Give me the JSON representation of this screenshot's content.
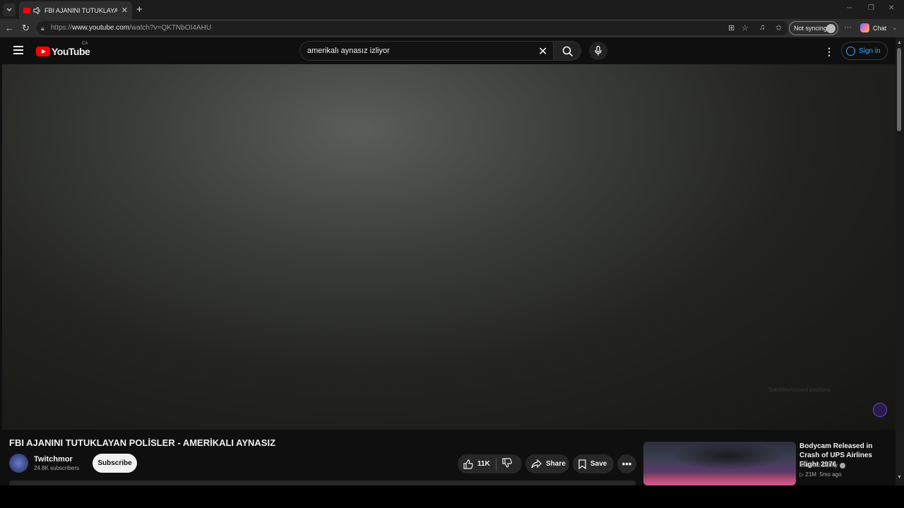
{
  "browser": {
    "tab_title": "FBI AJANINI TUTUKLAYAN POLİSLER - AMERİKALI AYNASIZ",
    "url_prefix": "https://",
    "url_host": "www.youtube.com",
    "url_path": "/watch?v=QKTNbOI4AHU",
    "sync_label": "Not syncing",
    "chat_label": "Chat"
  },
  "youtube": {
    "logo_text": "YouTube",
    "country_code": "CA",
    "search_value": "amerikalı aynasız izliyor",
    "sign_in_label": "Sign in"
  },
  "player": {
    "captions_text": "Subtitles/closed captions"
  },
  "video": {
    "title": "FBI AJANINI TUTUKLAYAN POLİSLER - AMERİKALI AYNASIZ",
    "channel_name": "Twitchmor",
    "subscribers": "24.8K subscribers",
    "subscribe_label": "Subscribe",
    "likes": "11K",
    "share_label": "Share",
    "save_label": "Save"
  },
  "recommended": [
    {
      "title": "Bodycam Released in Crash of UPS Airlines Flight 2976",
      "channel": "Midwest Safety",
      "views": "21M",
      "age": "5mo ago"
    }
  ]
}
